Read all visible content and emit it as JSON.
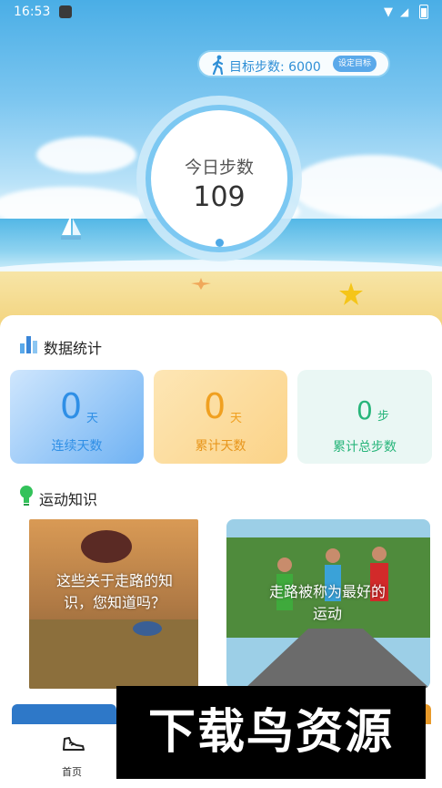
{
  "status_bar": {
    "time": "16:53"
  },
  "goal": {
    "text": "目标步数: 6000",
    "button": "设定目标"
  },
  "today": {
    "label": "今日步数",
    "value": "109"
  },
  "stats": {
    "title": "数据统计",
    "cards": [
      {
        "value": "0",
        "unit": "天",
        "caption": "连续天数",
        "color": "#2f8fe6"
      },
      {
        "value": "0",
        "unit": "天",
        "caption": "累计天数",
        "color": "#f0a020"
      },
      {
        "value": "0",
        "unit": "步",
        "caption": "累计总步数",
        "color": "#27b57a"
      }
    ]
  },
  "knowledge": {
    "title": "运动知识",
    "items": [
      {
        "text": "这些关于走路的知识，您知道吗？"
      },
      {
        "text": "走路被称为最好的运动"
      }
    ]
  },
  "nav": {
    "home_label": "首页"
  },
  "watermark": "下载鸟资源"
}
